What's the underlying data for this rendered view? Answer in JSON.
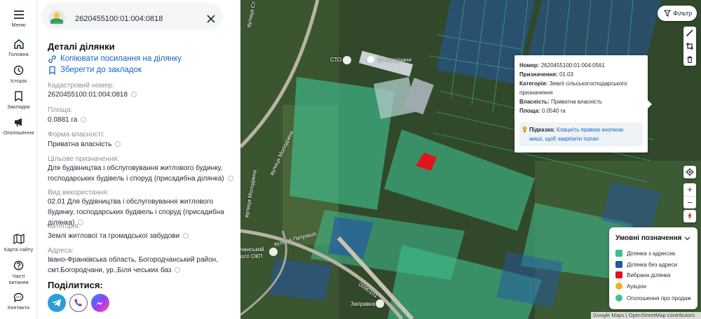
{
  "nav": {
    "items": [
      {
        "key": "menu",
        "label": "Меню"
      },
      {
        "key": "home",
        "label": "Головна"
      },
      {
        "key": "history",
        "label": "Історія"
      },
      {
        "key": "bookmarks",
        "label": "Закладки"
      },
      {
        "key": "announcements",
        "label": "Оголошення"
      },
      {
        "key": "sitemap",
        "label": "Карта сайту"
      },
      {
        "key": "faq",
        "label": "Часті питання"
      },
      {
        "key": "contacts",
        "label": "Контакти"
      }
    ]
  },
  "search": {
    "value": "2620455100:01:004:0818"
  },
  "details": {
    "title": "Деталі ділянки",
    "copy_link_label": "Копіювати посилання на ділянку",
    "save_bookmark_label": "Зберегти до закладок",
    "fields": [
      {
        "label": "Кадастровий номер:",
        "value": "2620455100:01:004:0818"
      },
      {
        "label": "Площа:",
        "value": "0.0881 га"
      },
      {
        "label": "Форма власності:",
        "value": "Приватна власність"
      },
      {
        "label": "Цільове призначення:",
        "value": "Для будівництва і обслуговування житлового будинку, господарських будівель і споруд (присадибна ділянка)"
      },
      {
        "label": "Вид використання:",
        "value": "02.01 Для будівництва і обслуговування житлового будинку, господарських будівель і споруд (присадибна ділянка)"
      },
      {
        "label": "Категорія:",
        "value": "Землі житлової та громадської забудови"
      },
      {
        "label": "Адреса:",
        "value": "Івано-Франківська область, Богородчанський район, смт.Богородчани, ур.,Біля чеських баз"
      }
    ],
    "share_title": "Поділитися:"
  },
  "map": {
    "filter_label": "Фільтр",
    "labels": {
      "street_1": "вулиця Ст",
      "street_2": "вулиця Молодіжна",
      "street_3": "вулиця Молодіжна",
      "street_4": "вулиця Петраша",
      "road": "0090101",
      "place_1": "СТО",
      "place_2": "Богородчани",
      "place_3": "Заправка",
      "place_4": "чанський",
      "place_5": "осп ОКП"
    },
    "popup": {
      "number_label": "Номер:",
      "number": "2620455100:01:004:0561",
      "purpose_label": "Призначення:",
      "purpose": "01.03",
      "category_label": "Категорія:",
      "category": "Землі сільськогосподарського призначення",
      "ownership_label": "Власність:",
      "ownership": "Приватна власність",
      "area_label": "Площа:",
      "area": "0.0540 га",
      "hint_label": "Підказка:",
      "hint": "Клацніть правою кнопкою миші, щоб закріпити попап"
    },
    "legend": {
      "title": "Умовні позначення",
      "items": [
        {
          "label": "Ділянка з адресою",
          "color": "#3fbf8f"
        },
        {
          "label": "Ділянка без адреси",
          "color": "#2356a8"
        },
        {
          "label": "Вибрана ділянка",
          "color": "#e0141e"
        },
        {
          "label": "Аукціон",
          "color": "#f2b01e"
        },
        {
          "label": "Оголошення про продаж",
          "color": "#3fbf8f"
        }
      ]
    },
    "attribution": "Google Maps | OpenStreetMap contributors"
  }
}
